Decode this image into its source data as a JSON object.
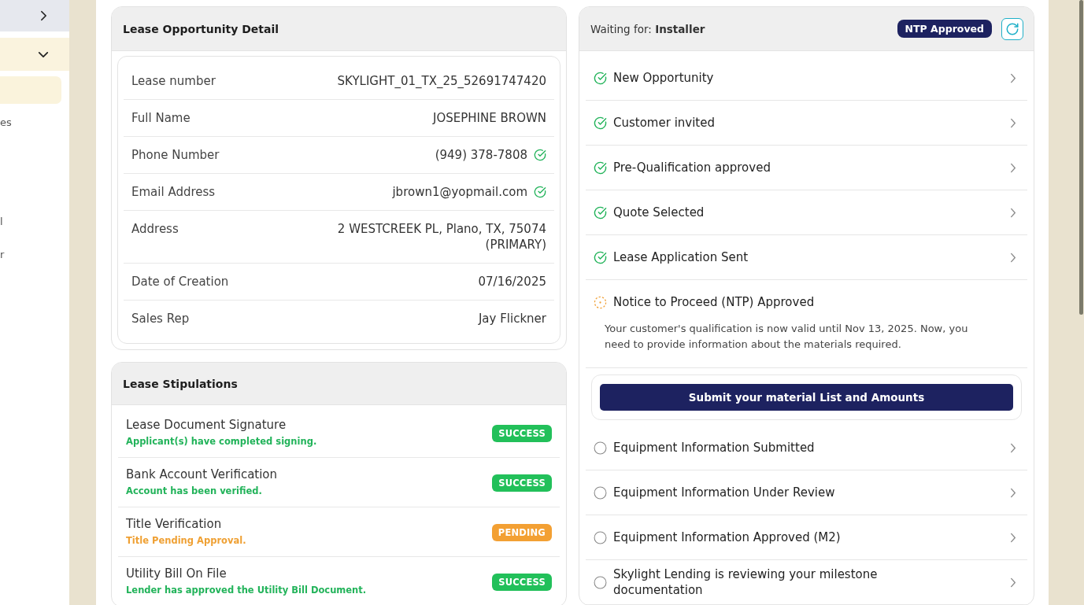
{
  "sidebar": {
    "group": {
      "expanded": true
    },
    "items": [
      {
        "selected": true
      },
      {
        "label": "es",
        "selected": false
      },
      {
        "label": "l",
        "selected": false
      },
      {
        "label": "r",
        "selected": false
      }
    ]
  },
  "lease_detail": {
    "title": "Lease Opportunity Detail",
    "rows": [
      {
        "label": "Lease number",
        "value": "SKYLIGHT_01_TX_25_52691747420",
        "verified": false
      },
      {
        "label": "Full Name",
        "value": "JOSEPHINE BROWN",
        "verified": false
      },
      {
        "label": "Phone Number",
        "value": "(949) 378-7808",
        "verified": true
      },
      {
        "label": "Email Address",
        "value": "jbrown1@yopmail.com",
        "verified": true
      },
      {
        "label": "Address",
        "value": "2 WESTCREEK PL, Plano, TX, 75074 (PRIMARY)",
        "verified": false
      },
      {
        "label": "Date of Creation",
        "value": "07/16/2025",
        "verified": false
      },
      {
        "label": "Sales Rep",
        "value": "Jay Flickner",
        "verified": false
      }
    ]
  },
  "stipulations": {
    "title": "Lease Stipulations",
    "items": [
      {
        "title": "Lease Document Signature",
        "note": "Applicant(s) have completed signing.",
        "kind": "success",
        "badge": "SUCCESS"
      },
      {
        "title": "Bank Account Verification",
        "note": "Account has been verified.",
        "kind": "success",
        "badge": "SUCCESS"
      },
      {
        "title": "Title Verification",
        "note": "Title Pending Approval.",
        "kind": "pending",
        "badge": "PENDING"
      },
      {
        "title": "Utility Bill On File",
        "note": "Lender has approved the Utility Bill Document.",
        "kind": "success",
        "badge": "SUCCESS"
      }
    ]
  },
  "progress": {
    "waiting_for": "Waiting for: **Installer**",
    "badge": "NTP Approved",
    "steps": [
      {
        "label": "New Opportunity",
        "kind": "done",
        "expanded": false
      },
      {
        "label": "Customer invited",
        "kind": "done",
        "expanded": false
      },
      {
        "label": "Pre-Qualification approved",
        "kind": "done",
        "expanded": false
      },
      {
        "label": "Quote Selected",
        "kind": "done",
        "expanded": false
      },
      {
        "label": "Lease Application Sent",
        "kind": "done",
        "expanded": false
      },
      {
        "label": "Notice to Proceed (NTP) Approved",
        "kind": "current",
        "expanded": true,
        "description": "Your customer's qualification is now valid until Nov 13, 2025. Now, you need to provide information about the materials required.",
        "action": "Submit your material List and Amounts"
      },
      {
        "label": "Equipment Information Submitted",
        "kind": "todo",
        "expanded": false
      },
      {
        "label": "Equipment Information Under Review",
        "kind": "todo",
        "expanded": false
      },
      {
        "label": "Equipment Information Approved (M2)",
        "kind": "todo",
        "expanded": false
      },
      {
        "label": "Skylight Lending is reviewing your milestone documentation",
        "kind": "todo",
        "expanded": false
      }
    ]
  }
}
